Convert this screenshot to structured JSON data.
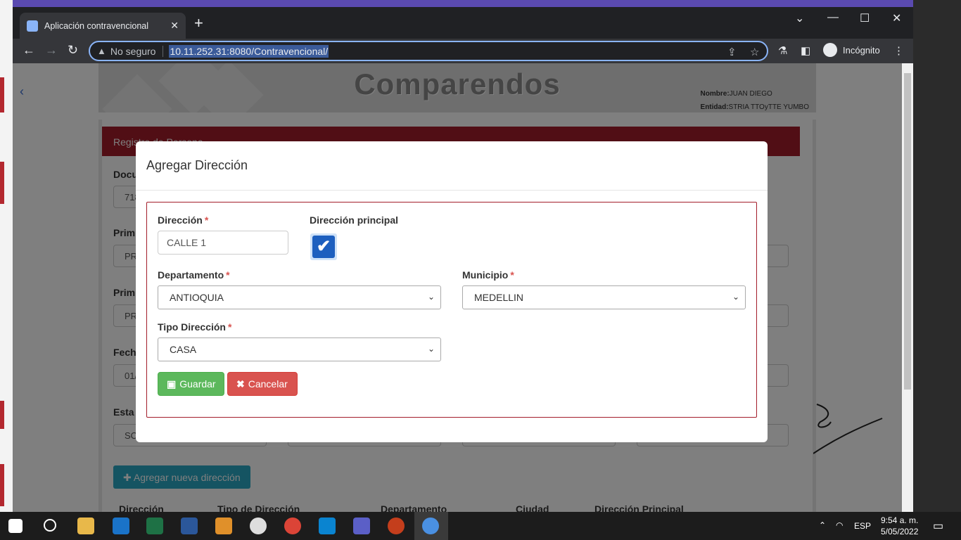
{
  "browser": {
    "tab_title": "Aplicación contravencional",
    "new_tab_symbol": "+",
    "security_label": "No seguro",
    "url": "10.11.252.31:8080/Contravencional/",
    "profile_label": "Incógnito"
  },
  "app": {
    "title": "Comparendos",
    "user_name_label": "Nombre:",
    "user_name": "JUAN DIEGO",
    "entity_label": "Entidad:",
    "entity": "STRIA TTOyTTE YUMBO"
  },
  "background_form": {
    "panel_title": "Registro de Persona",
    "labels": [
      "Docu",
      "Prim",
      "Prim",
      "Fech",
      "Esta"
    ],
    "values": [
      "718",
      "PR",
      "PR",
      "01/",
      "SO"
    ],
    "add_address_button": "Agregar nueva dirección",
    "table_headers": [
      "Dirección",
      "Tipo de Dirección",
      "Departamento",
      "Ciudad",
      "Dirección Principal"
    ]
  },
  "modal": {
    "title": "Agregar Dirección",
    "direccion_label": "Dirección",
    "direccion_value": "CALLE 1",
    "principal_label": "Dirección principal",
    "principal_checked": true,
    "departamento_label": "Departamento",
    "departamento_value": "ANTIOQUIA",
    "municipio_label": "Municipio",
    "municipio_value": "MEDELLIN",
    "tipo_label": "Tipo Dirección",
    "tipo_value": "CASA",
    "required_mark": "*",
    "save_button": "Guardar",
    "cancel_button": "Cancelar"
  },
  "taskbar": {
    "language": "ESP",
    "time": "9:54 a. m.",
    "date": "5/05/2022"
  },
  "colors": {
    "panel_red": "#a31d2a",
    "save_green": "#5cb85c",
    "cancel_red": "#d9534f",
    "checkbox_blue": "#1d5fbf",
    "add_button_teal": "#2aa9c4"
  }
}
